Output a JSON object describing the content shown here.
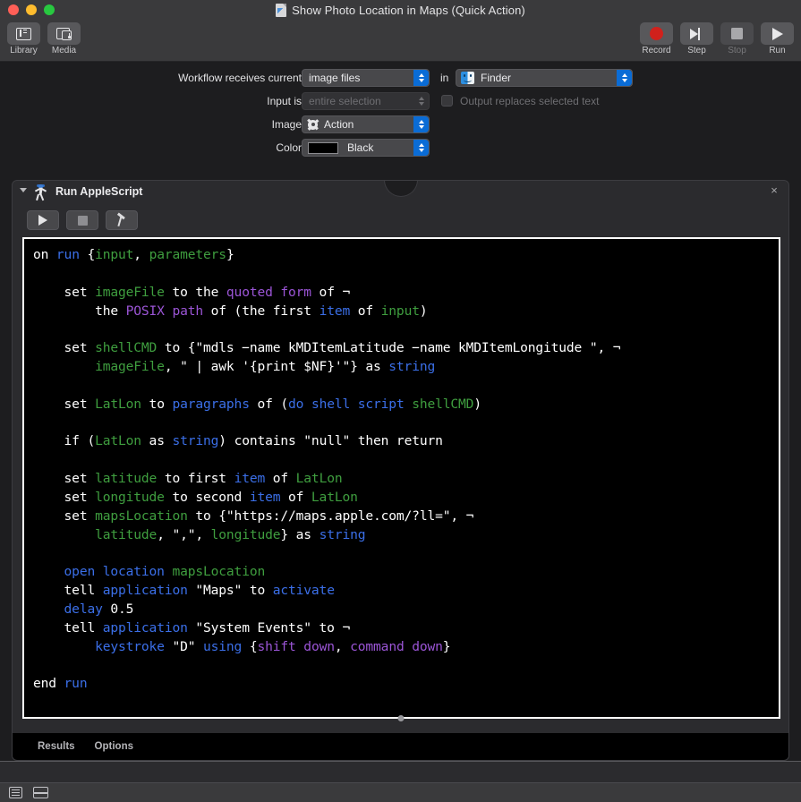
{
  "window": {
    "title": "Show Photo Location in Maps (Quick Action)",
    "doc_icon": "workflow-document-icon",
    "close_label": "",
    "minimize_label": "",
    "maximize_label": ""
  },
  "toolbar": {
    "left": [
      {
        "label": "Library",
        "icon": "library-icon",
        "enabled": true
      },
      {
        "label": "Media",
        "icon": "media-icon",
        "enabled": true
      }
    ],
    "right": [
      {
        "label": "Record",
        "icon": "record-icon",
        "enabled": true
      },
      {
        "label": "Step",
        "icon": "step-icon",
        "enabled": true
      },
      {
        "label": "Stop",
        "icon": "stop-icon",
        "enabled": false
      },
      {
        "label": "Run",
        "icon": "run-icon",
        "enabled": true
      }
    ]
  },
  "settings": {
    "receives_label": "Workflow receives current",
    "receives_value": "image files",
    "in_word": "in",
    "app_value": "Finder",
    "app_icon": "finder-icon",
    "input_is_label": "Input is",
    "input_is_value": "entire selection",
    "output_replaces_label": "Output replaces selected text",
    "output_replaces_checked": false,
    "image_label": "Image",
    "image_value": "Action",
    "image_icon": "gear-icon",
    "color_label": "Color",
    "color_value": "Black",
    "color_swatch": "#000000"
  },
  "action": {
    "title": "Run AppleScript",
    "icon": "applescript-runner-icon",
    "close_label": "×",
    "buttons": [
      {
        "name": "run-script-button",
        "icon": "play-icon"
      },
      {
        "name": "stop-script-button",
        "icon": "stop-icon"
      },
      {
        "name": "compile-script-button",
        "icon": "hammer-icon"
      }
    ],
    "footer": [
      {
        "label": "Results"
      },
      {
        "label": "Options"
      }
    ],
    "code_lines": [
      [
        {
          "t": "on ",
          "c": ""
        },
        {
          "t": "run ",
          "c": "kw"
        },
        {
          "t": "{",
          "c": ""
        },
        {
          "t": "input",
          "c": "var"
        },
        {
          "t": ", ",
          "c": ""
        },
        {
          "t": "parameters",
          "c": "var"
        },
        {
          "t": "}",
          "c": ""
        }
      ],
      [],
      [
        {
          "t": "    set ",
          "c": ""
        },
        {
          "t": "imageFile",
          "c": "var"
        },
        {
          "t": " to the ",
          "c": ""
        },
        {
          "t": "quoted form",
          "c": "pr"
        },
        {
          "t": " of ¬",
          "c": ""
        }
      ],
      [
        {
          "t": "        the ",
          "c": ""
        },
        {
          "t": "POSIX path",
          "c": "pr"
        },
        {
          "t": " of (the first ",
          "c": ""
        },
        {
          "t": "item",
          "c": "kw"
        },
        {
          "t": " of ",
          "c": ""
        },
        {
          "t": "input",
          "c": "var"
        },
        {
          "t": ")",
          "c": ""
        }
      ],
      [],
      [
        {
          "t": "    set ",
          "c": ""
        },
        {
          "t": "shellCMD",
          "c": "var"
        },
        {
          "t": " to {\"mdls −name kMDItemLatitude −name kMDItemLongitude \", ¬",
          "c": ""
        }
      ],
      [
        {
          "t": "        ",
          "c": ""
        },
        {
          "t": "imageFile",
          "c": "var"
        },
        {
          "t": ", \" | awk '{print $NF}'\"} as ",
          "c": ""
        },
        {
          "t": "string",
          "c": "kw"
        }
      ],
      [],
      [
        {
          "t": "    set ",
          "c": ""
        },
        {
          "t": "LatLon",
          "c": "var"
        },
        {
          "t": " to ",
          "c": ""
        },
        {
          "t": "paragraphs",
          "c": "kw"
        },
        {
          "t": " of (",
          "c": ""
        },
        {
          "t": "do shell script",
          "c": "kw"
        },
        {
          "t": " ",
          "c": ""
        },
        {
          "t": "shellCMD",
          "c": "var"
        },
        {
          "t": ")",
          "c": ""
        }
      ],
      [],
      [
        {
          "t": "    if (",
          "c": ""
        },
        {
          "t": "LatLon",
          "c": "var"
        },
        {
          "t": " as ",
          "c": ""
        },
        {
          "t": "string",
          "c": "kw"
        },
        {
          "t": ") contains \"null\" then return",
          "c": ""
        }
      ],
      [],
      [
        {
          "t": "    set ",
          "c": ""
        },
        {
          "t": "latitude",
          "c": "var"
        },
        {
          "t": " to first ",
          "c": ""
        },
        {
          "t": "item",
          "c": "kw"
        },
        {
          "t": " of ",
          "c": ""
        },
        {
          "t": "LatLon",
          "c": "var"
        }
      ],
      [
        {
          "t": "    set ",
          "c": ""
        },
        {
          "t": "longitude",
          "c": "var"
        },
        {
          "t": " to second ",
          "c": ""
        },
        {
          "t": "item",
          "c": "kw"
        },
        {
          "t": " of ",
          "c": ""
        },
        {
          "t": "LatLon",
          "c": "var"
        }
      ],
      [
        {
          "t": "    set ",
          "c": ""
        },
        {
          "t": "mapsLocation",
          "c": "var"
        },
        {
          "t": " to {\"https://maps.apple.com/?ll=\", ¬",
          "c": ""
        }
      ],
      [
        {
          "t": "        ",
          "c": ""
        },
        {
          "t": "latitude",
          "c": "var"
        },
        {
          "t": ", \",\", ",
          "c": ""
        },
        {
          "t": "longitude",
          "c": "var"
        },
        {
          "t": "} as ",
          "c": ""
        },
        {
          "t": "string",
          "c": "kw"
        }
      ],
      [],
      [
        {
          "t": "    ",
          "c": ""
        },
        {
          "t": "open location",
          "c": "kw"
        },
        {
          "t": " ",
          "c": ""
        },
        {
          "t": "mapsLocation",
          "c": "var"
        }
      ],
      [
        {
          "t": "    tell ",
          "c": ""
        },
        {
          "t": "application",
          "c": "kw"
        },
        {
          "t": " \"Maps\" to ",
          "c": ""
        },
        {
          "t": "activate",
          "c": "kw"
        }
      ],
      [
        {
          "t": "    ",
          "c": ""
        },
        {
          "t": "delay",
          "c": "kw"
        },
        {
          "t": " 0.5",
          "c": ""
        }
      ],
      [
        {
          "t": "    tell ",
          "c": ""
        },
        {
          "t": "application",
          "c": "kw"
        },
        {
          "t": " \"System Events\" to ¬",
          "c": ""
        }
      ],
      [
        {
          "t": "        ",
          "c": ""
        },
        {
          "t": "keystroke",
          "c": "kw"
        },
        {
          "t": " \"D\" ",
          "c": ""
        },
        {
          "t": "using",
          "c": "kw"
        },
        {
          "t": " {",
          "c": ""
        },
        {
          "t": "shift down",
          "c": "pr"
        },
        {
          "t": ", ",
          "c": ""
        },
        {
          "t": "command down",
          "c": "pr"
        },
        {
          "t": "}",
          "c": ""
        }
      ],
      [],
      [
        {
          "t": "end ",
          "c": ""
        },
        {
          "t": "run",
          "c": "kw"
        }
      ]
    ]
  },
  "status_bar": {
    "icons": [
      {
        "name": "list-view-icon"
      },
      {
        "name": "log-view-icon"
      }
    ]
  },
  "colors": {
    "accent_blue": "#0a6cd6",
    "keyword": "#3b6fe8",
    "variable": "#3f9e3f",
    "property": "#9b55d6",
    "record_red": "#d0211c",
    "editor_bg": "#000000"
  }
}
